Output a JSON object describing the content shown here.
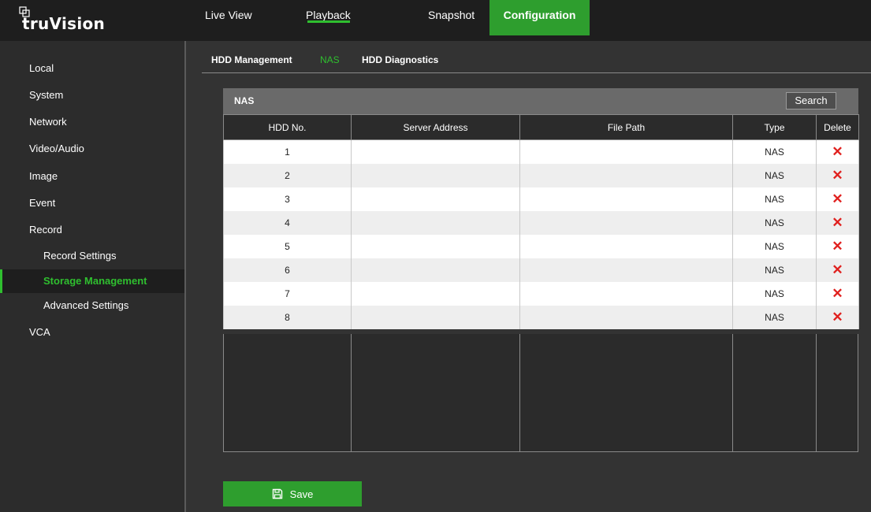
{
  "app": {
    "brand": "truVision"
  },
  "nav": [
    {
      "label": "Live View"
    },
    {
      "label": "Playback"
    },
    {
      "label": "Snapshot"
    },
    {
      "label": "Configuration",
      "active": true
    }
  ],
  "sidebar": {
    "items": [
      {
        "label": "Local"
      },
      {
        "label": "System"
      },
      {
        "label": "Network"
      },
      {
        "label": "Video/Audio"
      },
      {
        "label": "Image"
      },
      {
        "label": "Event"
      },
      {
        "label": "Record"
      },
      {
        "label": "Record Settings"
      },
      {
        "label": "Storage Management",
        "active": true
      },
      {
        "label": "Advanced Settings"
      },
      {
        "label": "VCA"
      }
    ]
  },
  "subtabs": [
    {
      "label": "HDD Management"
    },
    {
      "label": "NAS",
      "active": true
    },
    {
      "label": "HDD Diagnostics"
    }
  ],
  "panel": {
    "title": "NAS",
    "search_label": "Search",
    "columns": [
      "HDD No.",
      "Server Address",
      "File Path",
      "Type",
      "Delete"
    ],
    "rows": [
      {
        "hdd_no": "1",
        "server_address": "",
        "file_path": "",
        "type": "NAS"
      },
      {
        "hdd_no": "2",
        "server_address": "",
        "file_path": "",
        "type": "NAS"
      },
      {
        "hdd_no": "3",
        "server_address": "",
        "file_path": "",
        "type": "NAS"
      },
      {
        "hdd_no": "4",
        "server_address": "",
        "file_path": "",
        "type": "NAS"
      },
      {
        "hdd_no": "5",
        "server_address": "",
        "file_path": "",
        "type": "NAS"
      },
      {
        "hdd_no": "6",
        "server_address": "",
        "file_path": "",
        "type": "NAS"
      },
      {
        "hdd_no": "7",
        "server_address": "",
        "file_path": "",
        "type": "NAS"
      },
      {
        "hdd_no": "8",
        "server_address": "",
        "file_path": "",
        "type": "NAS"
      }
    ],
    "delete_icon": "close-icon"
  },
  "save": {
    "label": "Save",
    "icon": "floppy-disk-icon"
  },
  "colors": {
    "accent": "#2e9e2e",
    "accent_text": "#2fbf2f",
    "delete": "#e0201e",
    "topbar": "#1e1e1e",
    "background": "#333333"
  }
}
